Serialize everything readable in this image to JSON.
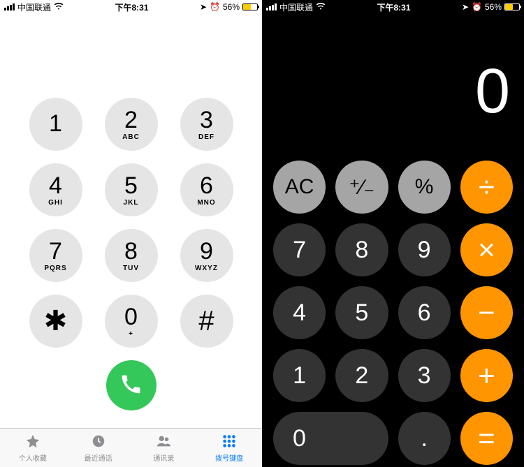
{
  "status": {
    "carrier": "中国联通",
    "time": "下午8:31",
    "battery_pct": "56%",
    "battery_fill_pct": 56
  },
  "phone": {
    "keys": [
      {
        "d": "1",
        "l": ""
      },
      {
        "d": "2",
        "l": "ABC"
      },
      {
        "d": "3",
        "l": "DEF"
      },
      {
        "d": "4",
        "l": "GHI"
      },
      {
        "d": "5",
        "l": "JKL"
      },
      {
        "d": "6",
        "l": "MNO"
      },
      {
        "d": "7",
        "l": "PQRS"
      },
      {
        "d": "8",
        "l": "TUV"
      },
      {
        "d": "9",
        "l": "WXYZ"
      },
      {
        "d": "✱",
        "l": ""
      },
      {
        "d": "0",
        "l": "+"
      },
      {
        "d": "#",
        "l": ""
      }
    ],
    "tabs": [
      {
        "label": "个人收藏"
      },
      {
        "label": "最近通话"
      },
      {
        "label": "通讯录"
      },
      {
        "label": "拨号键盘"
      }
    ]
  },
  "calc": {
    "display": "0",
    "buttons": {
      "ac": "AC",
      "pm": "⁺∕₋",
      "pct": "%",
      "div": "÷",
      "7": "7",
      "8": "8",
      "9": "9",
      "mul": "×",
      "4": "4",
      "5": "5",
      "6": "6",
      "sub": "−",
      "1": "1",
      "2": "2",
      "3": "3",
      "add": "+",
      "0": "0",
      "dot": ".",
      "eq": "="
    }
  }
}
